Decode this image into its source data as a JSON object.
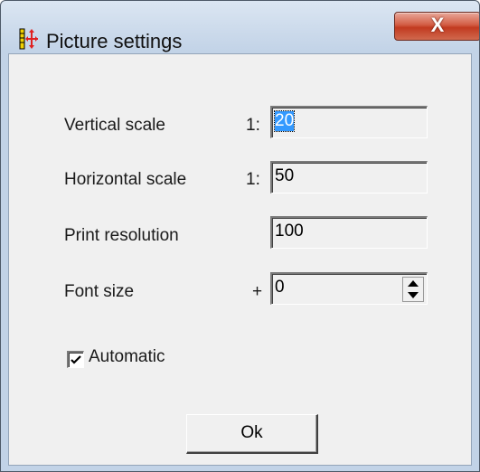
{
  "window": {
    "title": "Picture settings",
    "close_label": "X"
  },
  "fields": {
    "vertical_scale": {
      "label": "Vertical scale",
      "prefix": "1:",
      "value": "20"
    },
    "horizontal_scale": {
      "label": "Horizontal scale",
      "prefix": "1:",
      "value": "50"
    },
    "print_resolution": {
      "label": "Print resolution",
      "value": "100"
    },
    "font_size": {
      "label": "Font size",
      "prefix": "+",
      "value": "0"
    }
  },
  "automatic": {
    "label": "Automatic",
    "checked": true
  },
  "ok_button": {
    "label": "Ok"
  },
  "colors": {
    "selection": "#3399ff",
    "close_button": "#c23a20",
    "dialog_background": "#f0f0f0",
    "icon_red": "#e02020",
    "icon_yellow": "#f0d000"
  },
  "icons": {
    "app": "picture-settings-icon",
    "spinner_up": "up-arrow-icon",
    "spinner_down": "down-arrow-icon",
    "check": "checkmark-icon"
  }
}
